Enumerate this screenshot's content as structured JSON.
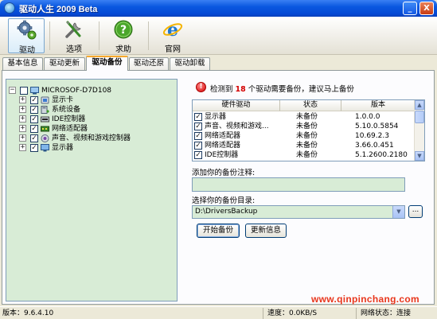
{
  "window": {
    "title": "驱动人生 2009 Beta",
    "controls": {
      "minimize": "_",
      "close": "X"
    }
  },
  "toolbar": {
    "items": [
      {
        "label": "驱动",
        "icon": "gear-icon",
        "active": true
      },
      {
        "label": "选项",
        "icon": "tools-icon",
        "active": false
      },
      {
        "label": "求助",
        "icon": "help-icon",
        "active": false
      },
      {
        "label": "官网",
        "icon": "ie-globe-icon",
        "active": false
      }
    ]
  },
  "tabs": [
    {
      "label": "基本信息",
      "active": false
    },
    {
      "label": "驱动更新",
      "active": false
    },
    {
      "label": "驱动备份",
      "active": true
    },
    {
      "label": "驱动还原",
      "active": false
    },
    {
      "label": "驱动卸载",
      "active": false
    }
  ],
  "tree": {
    "root": {
      "label": "MICROSOF-D7D108",
      "expander": "−",
      "checked": false
    },
    "children": [
      {
        "label": "显示卡",
        "expander": "+",
        "checked": true,
        "icon": "display-card-icon"
      },
      {
        "label": "系统设备",
        "expander": "+",
        "checked": true,
        "icon": "system-device-icon"
      },
      {
        "label": "IDE控制器",
        "expander": "+",
        "checked": true,
        "icon": "ide-controller-icon"
      },
      {
        "label": "网络适配器",
        "expander": "+",
        "checked": true,
        "icon": "network-adapter-icon"
      },
      {
        "label": "声音、视频和游戏控制器",
        "expander": "+",
        "checked": true,
        "icon": "sound-icon"
      },
      {
        "label": "显示器",
        "expander": "+",
        "checked": true,
        "icon": "monitor-icon"
      }
    ]
  },
  "notice": {
    "prefix": "检测到",
    "count": "18",
    "suffix": "个驱动需要备份，建议马上备份",
    "icon": "alert-icon",
    "count_color": "#d40000"
  },
  "table": {
    "headers": [
      "硬件驱动",
      "状态",
      "版本"
    ],
    "rows": [
      {
        "name": "显示器",
        "status": "未备份",
        "version": "1.0.0.0",
        "checked": true
      },
      {
        "name": "声音、视频和游戏...",
        "status": "未备份",
        "version": "5.10.0.5854",
        "checked": true
      },
      {
        "name": "网络适配器",
        "status": "未备份",
        "version": "10.69.2.3",
        "checked": true
      },
      {
        "name": "网络适配器",
        "status": "未备份",
        "version": "3.66.0.451",
        "checked": true
      },
      {
        "name": "IDE控制器",
        "status": "未备份",
        "version": "5.1.2600.2180",
        "checked": true
      }
    ]
  },
  "backup_note": {
    "label": "添加你的备份注释:",
    "value": ""
  },
  "backup_dir": {
    "label": "选择你的备份目录:",
    "value": "D:\\DriversBackup",
    "browse_label": "..."
  },
  "buttons": {
    "start_backup": "开始备份",
    "update_info": "更新信息"
  },
  "status": {
    "version": "版本：9.6.4.10",
    "speed": "速度：0.0KB/S",
    "network": "网络状态：连接"
  },
  "watermark": "www.qinpinchang.com",
  "colors": {
    "tree_bg": "#d8ecd6",
    "titlebar": "#0548d4",
    "tab_accent": "#f7a82c"
  }
}
